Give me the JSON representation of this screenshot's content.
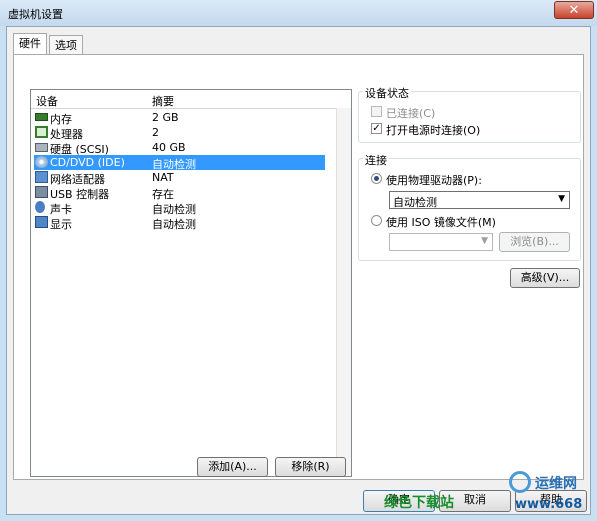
{
  "window": {
    "title": "虚拟机设置",
    "close_glyph": "✕"
  },
  "tabs": [
    {
      "label": "硬件"
    },
    {
      "label": "选项"
    }
  ],
  "device_list": {
    "headers": {
      "device": "设备",
      "summary": "摘要"
    },
    "rows": [
      {
        "icon": "memory-icon",
        "device": "内存",
        "summary": "2 GB"
      },
      {
        "icon": "processor-icon",
        "device": "处理器",
        "summary": "2"
      },
      {
        "icon": "hard-disk-icon",
        "device": "硬盘 (SCSI)",
        "summary": "40 GB"
      },
      {
        "icon": "cd-dvd-icon",
        "device": "CD/DVD (IDE)",
        "summary": "自动检测",
        "selected": true
      },
      {
        "icon": "network-adapter-icon",
        "device": "网络适配器",
        "summary": "NAT"
      },
      {
        "icon": "usb-controller-icon",
        "device": "USB 控制器",
        "summary": "存在"
      },
      {
        "icon": "sound-card-icon",
        "device": "声卡",
        "summary": "自动检测"
      },
      {
        "icon": "display-icon",
        "device": "显示",
        "summary": "自动检测"
      }
    ]
  },
  "buttons": {
    "add": "添加(A)...",
    "remove": "移除(R)",
    "advanced": "高级(V)...",
    "browse": "浏览(B)...",
    "ok": "确定",
    "cancel": "取消",
    "help": "帮助"
  },
  "device_status": {
    "title": "设备状态",
    "connected": {
      "label": "已连接(C)",
      "checked": false,
      "disabled": true
    },
    "connect_at_power_on": {
      "label": "打开电源时连接(O)",
      "checked": true
    }
  },
  "connection": {
    "title": "连接",
    "physical_drive": {
      "label": "使用物理驱动器(P):",
      "selected": true
    },
    "drive_select": {
      "value": "自动检测"
    },
    "iso_image": {
      "label": "使用 ISO 镜像文件(M)",
      "selected": false
    },
    "iso_path": {
      "value": ""
    }
  },
  "watermark": {
    "brand": "运维网",
    "url": "www.668"
  },
  "overlay_text": "绿色下载站"
}
